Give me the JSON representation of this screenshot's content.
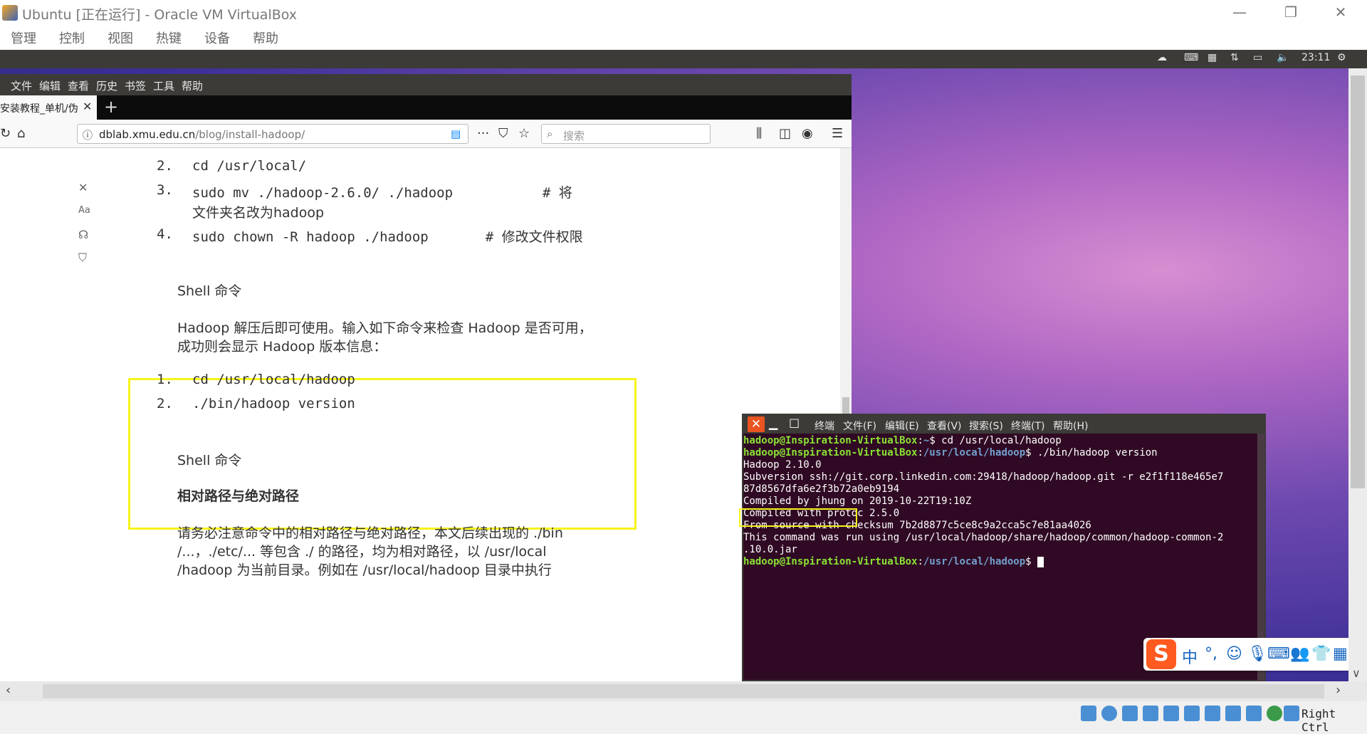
{
  "window": {
    "title": "Ubuntu [正在运行] - Oracle VM VirtualBox",
    "minimize": "—",
    "restore": "❐",
    "close": "✕"
  },
  "vbox_menu": [
    "管理",
    "控制",
    "视图",
    "热键",
    "设备",
    "帮助"
  ],
  "guest_topbar": {
    "clock": "23:11"
  },
  "browser": {
    "menu": [
      "文件",
      "编辑",
      "查看",
      "历史",
      "书签",
      "工具",
      "帮助"
    ],
    "tab": {
      "label": "安装教程_单机/伪",
      "close": "✕",
      "new": "+"
    },
    "url": {
      "host": "dblab.xmu.edu.cn",
      "path": "/blog/install-hadoop/"
    },
    "search_placeholder": "搜索",
    "content": {
      "list1": [
        {
          "n": "2.",
          "code": "cd /usr/local/"
        },
        {
          "n": "3.",
          "code": "sudo mv ./hadoop-2.6.0/ ./hadoop           # 将",
          "cont": "文件夹名改为hadoop"
        },
        {
          "n": "4.",
          "code": "sudo chown -R hadoop ./hadoop       # 修改文件权限"
        }
      ],
      "shell_label_1": "Shell 命令",
      "para1_line1": "Hadoop 解压后即可使用。输入如下命令来检查 Hadoop 是否可用，",
      "para1_line2": "成功则会显示 Hadoop 版本信息：",
      "list2": [
        {
          "n": "1.",
          "code": "cd /usr/local/hadoop"
        },
        {
          "n": "2.",
          "code": "./bin/hadoop version"
        }
      ],
      "shell_label_2": "Shell 命令",
      "heading": "相对路径与绝对路径",
      "para2_line1": "请务必注意命令中的相对路径与绝对路径，本文后续出现的 ./bin",
      "para2_line2": "/...，./etc/... 等包含 ./ 的路径，均为相对路径，以 /usr/local",
      "para2_line3": "/hadoop 为当前目录。例如在 /usr/local/hadoop 目录中执行"
    }
  },
  "terminal": {
    "menu": [
      "终端",
      "文件(F)",
      "编辑(E)",
      "查看(V)",
      "搜索(S)",
      "终端(T)",
      "帮助(H)"
    ],
    "prompt_user": "hadoop@Inspiration-VirtualBox",
    "line1_path": "~",
    "line1_cmd": "$ cd /usr/local/hadoop",
    "line2_path": "/usr/local/hadoop",
    "line2_cmd": "$ ./bin/hadoop version",
    "output": [
      "Hadoop 2.10.0",
      "Subversion ssh://git.corp.linkedin.com:29418/hadoop/hadoop.git -r e2f1f118e465e7",
      "87d8567dfa6e2f3b72a0eb9194",
      "Compiled by jhung on 2019-10-22T19:10Z",
      "Compiled with protoc 2.5.0",
      "From source with checksum 7b2d8877c5ce8c9a2cca5c7e81aa4026",
      "This command was run using /usr/local/hadoop/share/hadoop/common/hadoop-common-2",
      ".10.0.jar"
    ],
    "line_last_path": "/usr/local/hadoop",
    "line_last_cmd": "$ "
  },
  "ime": {
    "logo": "S",
    "lang": "中"
  },
  "status": {
    "host_key": "Right Ctrl"
  }
}
